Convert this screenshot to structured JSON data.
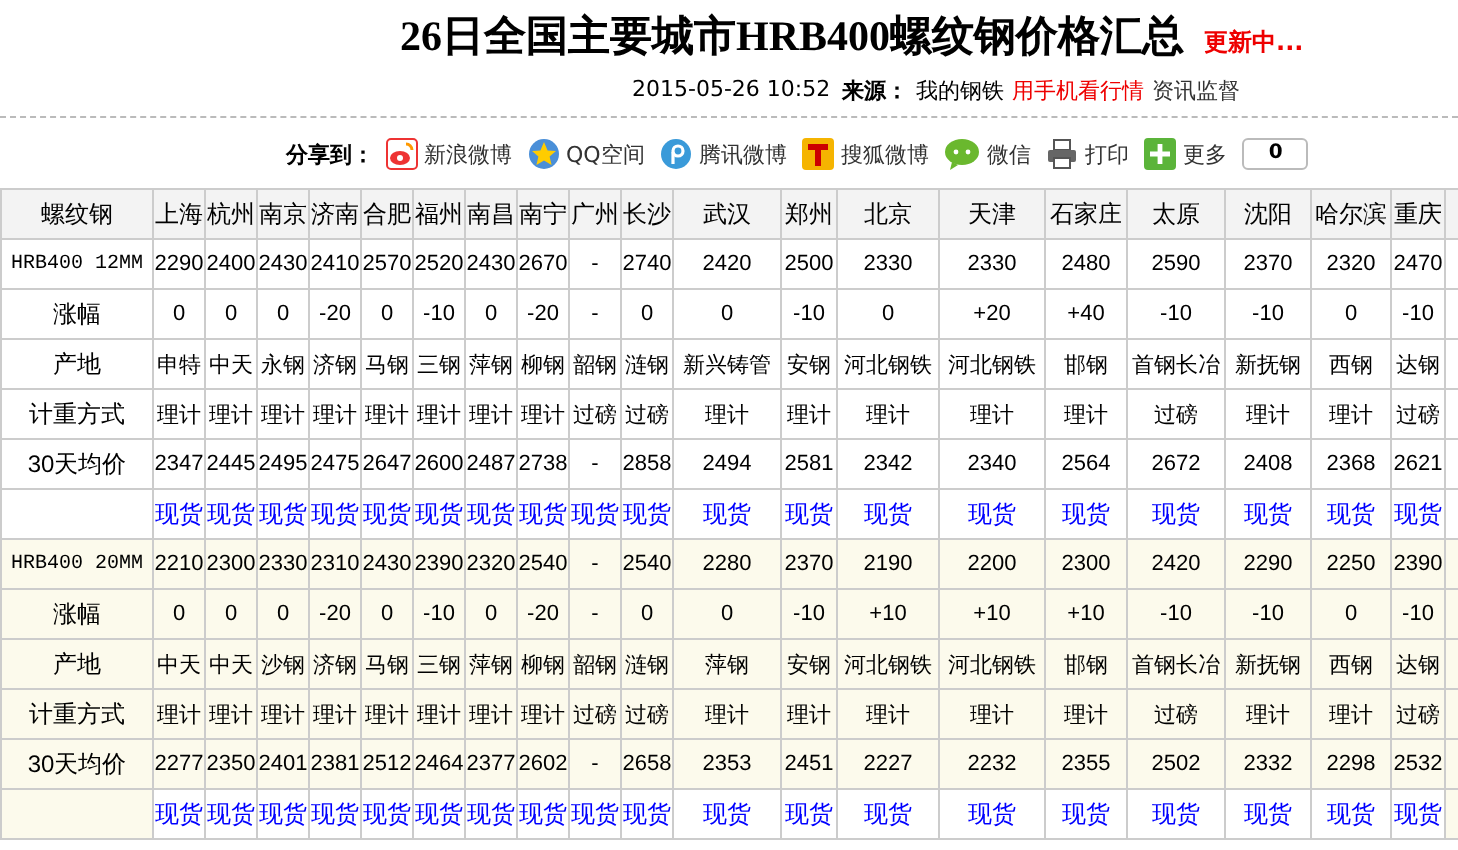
{
  "header": {
    "title": "26日全国主要城市HRB400螺纹钢价格汇总",
    "status": "更新中..."
  },
  "meta": {
    "datetime": "2015-05-26 10:52",
    "source_label": "来源：",
    "source": "我的钢铁",
    "mobile_link": "用手机看行情",
    "monitor": "资讯监督"
  },
  "share": {
    "label": "分享到：",
    "items": [
      {
        "kind": "sina",
        "label": "新浪微博"
      },
      {
        "kind": "qzone",
        "label": "QQ空间"
      },
      {
        "kind": "tencent",
        "label": "腾讯微博"
      },
      {
        "kind": "sohu",
        "label": "搜狐微博"
      },
      {
        "kind": "wechat",
        "label": "微信"
      },
      {
        "kind": "print",
        "label": "打印"
      },
      {
        "kind": "more",
        "label": "更多"
      }
    ],
    "count": "0"
  },
  "table": {
    "corner": "螺纹钢",
    "columns": [
      "上海",
      "杭州",
      "南京",
      "济南",
      "合肥",
      "福州",
      "南昌",
      "南宁",
      "广州",
      "长沙",
      "武汉",
      "郑州",
      "北京",
      "天津",
      "石家庄",
      "太原",
      "沈阳",
      "哈尔滨",
      "重庆"
    ],
    "blocks": [
      {
        "highlighted": false,
        "rows": [
          {
            "kind": "spec",
            "label": "HRB400 12MM",
            "cells": [
              "2290",
              "2400",
              "2430",
              "2410",
              "2570",
              "2520",
              "2430",
              "2670",
              "-",
              "2740",
              "2420",
              "2500",
              "2330",
              "2330",
              "2480",
              "2590",
              "2370",
              "2320",
              "2470"
            ]
          },
          {
            "kind": "text",
            "label": "涨幅",
            "cells": [
              "0",
              "0",
              "0",
              "-20",
              "0",
              "-10",
              "0",
              "-20",
              "-",
              "0",
              "0",
              "-10",
              "0",
              "+20",
              "+40",
              "-10",
              "-10",
              "0",
              "-10"
            ]
          },
          {
            "kind": "text",
            "label": "产地",
            "cells": [
              "申特",
              "中天",
              "永钢",
              "济钢",
              "马钢",
              "三钢",
              "萍钢",
              "柳钢",
              "韶钢",
              "涟钢",
              "新兴铸管",
              "安钢",
              "河北钢铁",
              "河北钢铁",
              "邯钢",
              "首钢长冶",
              "新抚钢",
              "西钢",
              "达钢"
            ]
          },
          {
            "kind": "text",
            "label": "计重方式",
            "cells": [
              "理计",
              "理计",
              "理计",
              "理计",
              "理计",
              "理计",
              "理计",
              "理计",
              "过磅",
              "过磅",
              "理计",
              "理计",
              "理计",
              "理计",
              "理计",
              "过磅",
              "理计",
              "理计",
              "过磅"
            ]
          },
          {
            "kind": "text",
            "label": "30天均价",
            "cells": [
              "2347",
              "2445",
              "2495",
              "2475",
              "2647",
              "2600",
              "2487",
              "2738",
              "-",
              "2858",
              "2494",
              "2581",
              "2342",
              "2340",
              "2564",
              "2672",
              "2408",
              "2368",
              "2621"
            ]
          },
          {
            "kind": "links",
            "cells": [
              "现货",
              "现货",
              "现货",
              "现货",
              "现货",
              "现货",
              "现货",
              "现货",
              "现货",
              "现货",
              "现货",
              "现货",
              "现货",
              "现货",
              "现货",
              "现货",
              "现货",
              "现货",
              "现货"
            ]
          }
        ]
      },
      {
        "highlighted": true,
        "rows": [
          {
            "kind": "spec",
            "label": "HRB400 20MM",
            "cells": [
              "2210",
              "2300",
              "2330",
              "2310",
              "2430",
              "2390",
              "2320",
              "2540",
              "-",
              "2540",
              "2280",
              "2370",
              "2190",
              "2200",
              "2300",
              "2420",
              "2290",
              "2250",
              "2390"
            ]
          },
          {
            "kind": "text",
            "label": "涨幅",
            "cells": [
              "0",
              "0",
              "0",
              "-20",
              "0",
              "-10",
              "0",
              "-20",
              "-",
              "0",
              "0",
              "-10",
              "+10",
              "+10",
              "+10",
              "-10",
              "-10",
              "0",
              "-10"
            ]
          },
          {
            "kind": "text",
            "label": "产地",
            "cells": [
              "中天",
              "中天",
              "沙钢",
              "济钢",
              "马钢",
              "三钢",
              "萍钢",
              "柳钢",
              "韶钢",
              "涟钢",
              "萍钢",
              "安钢",
              "河北钢铁",
              "河北钢铁",
              "邯钢",
              "首钢长冶",
              "新抚钢",
              "西钢",
              "达钢"
            ]
          },
          {
            "kind": "text",
            "label": "计重方式",
            "cells": [
              "理计",
              "理计",
              "理计",
              "理计",
              "理计",
              "理计",
              "理计",
              "理计",
              "过磅",
              "过磅",
              "理计",
              "理计",
              "理计",
              "理计",
              "理计",
              "过磅",
              "理计",
              "理计",
              "过磅"
            ]
          },
          {
            "kind": "text",
            "label": "30天均价",
            "cells": [
              "2277",
              "2350",
              "2401",
              "2381",
              "2512",
              "2464",
              "2377",
              "2602",
              "-",
              "2658",
              "2353",
              "2451",
              "2227",
              "2232",
              "2355",
              "2502",
              "2332",
              "2298",
              "2532"
            ]
          },
          {
            "kind": "links",
            "cells": [
              "现货",
              "现货",
              "现货",
              "现货",
              "现货",
              "现货",
              "现货",
              "现货",
              "现货",
              "现货",
              "现货",
              "现货",
              "现货",
              "现货",
              "现货",
              "现货",
              "现货",
              "现货",
              "现货"
            ]
          }
        ]
      }
    ]
  }
}
